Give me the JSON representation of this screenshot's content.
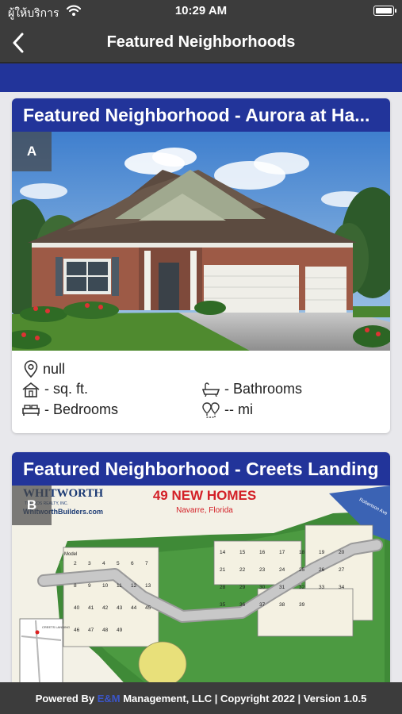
{
  "status_bar": {
    "carrier": "ผู้ให้บริการ",
    "time": "10:29 AM",
    "battery_level": 1.0
  },
  "nav": {
    "title": "Featured Neighborhoods"
  },
  "neighborhoods": [
    {
      "title": "Featured Neighborhood - Aurora at Ha...",
      "badge": "A",
      "location": "null",
      "sqft": "- sq. ft.",
      "bathrooms": "- Bathrooms",
      "bedrooms": "- Bedrooms",
      "distance": "-- mi"
    },
    {
      "title": "Featured Neighborhood - Creets Landing",
      "badge": "B",
      "map": {
        "builder_name": "WHITWORTH",
        "builder_sub": "THE ROS REALTY, INC.",
        "builder_url": "WhitworthBuilders.com",
        "headline": "49 NEW HOMES",
        "city": "Navarre, Florida",
        "road_label": "Robertson Ave",
        "inset_label": "CREETS LANDING",
        "model_label": "Model",
        "lots_left": [
          "2",
          "3",
          "4",
          "5",
          "6",
          "7",
          "8",
          "9",
          "10",
          "11",
          "12",
          "13",
          "40",
          "41",
          "42",
          "43",
          "44",
          "45",
          "46",
          "47",
          "48",
          "49"
        ],
        "lots_right": [
          "14",
          "15",
          "16",
          "17",
          "18",
          "19",
          "20",
          "21",
          "22",
          "23",
          "24",
          "25",
          "26",
          "27",
          "28",
          "29",
          "30",
          "31",
          "32",
          "33",
          "34",
          "35",
          "36",
          "37",
          "38",
          "39"
        ]
      }
    }
  ],
  "footer": {
    "prefix": "Powered By ",
    "brand": "E&M",
    "suffix": " Management, LLC | Copyright 2022 | Version 1.0.5"
  },
  "colors": {
    "accent": "#22349a",
    "bar": "#3c3c3c"
  }
}
